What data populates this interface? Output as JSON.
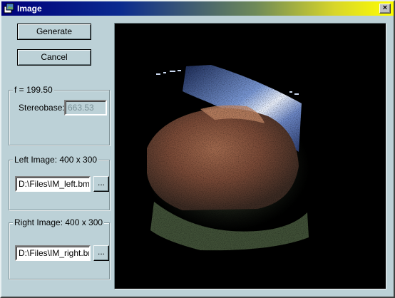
{
  "window": {
    "title": "Image",
    "close_glyph": "×",
    "icon": "app-icon"
  },
  "buttons": {
    "generate": "Generate",
    "cancel": "Cancel"
  },
  "focal_group": {
    "legend": "f = 199.50",
    "stereobase_label": "Stereobase:",
    "stereobase_value": "663.53"
  },
  "left_group": {
    "legend": "Left Image:  400 x  300",
    "file": "D:\\Files\\IM_left.bmp",
    "browse": "..."
  },
  "right_group": {
    "legend": "Right Image:  400 x  300",
    "file": "D:\\Files\\IM_right.bm",
    "browse": "..."
  },
  "preview": {
    "background": "#000000"
  }
}
